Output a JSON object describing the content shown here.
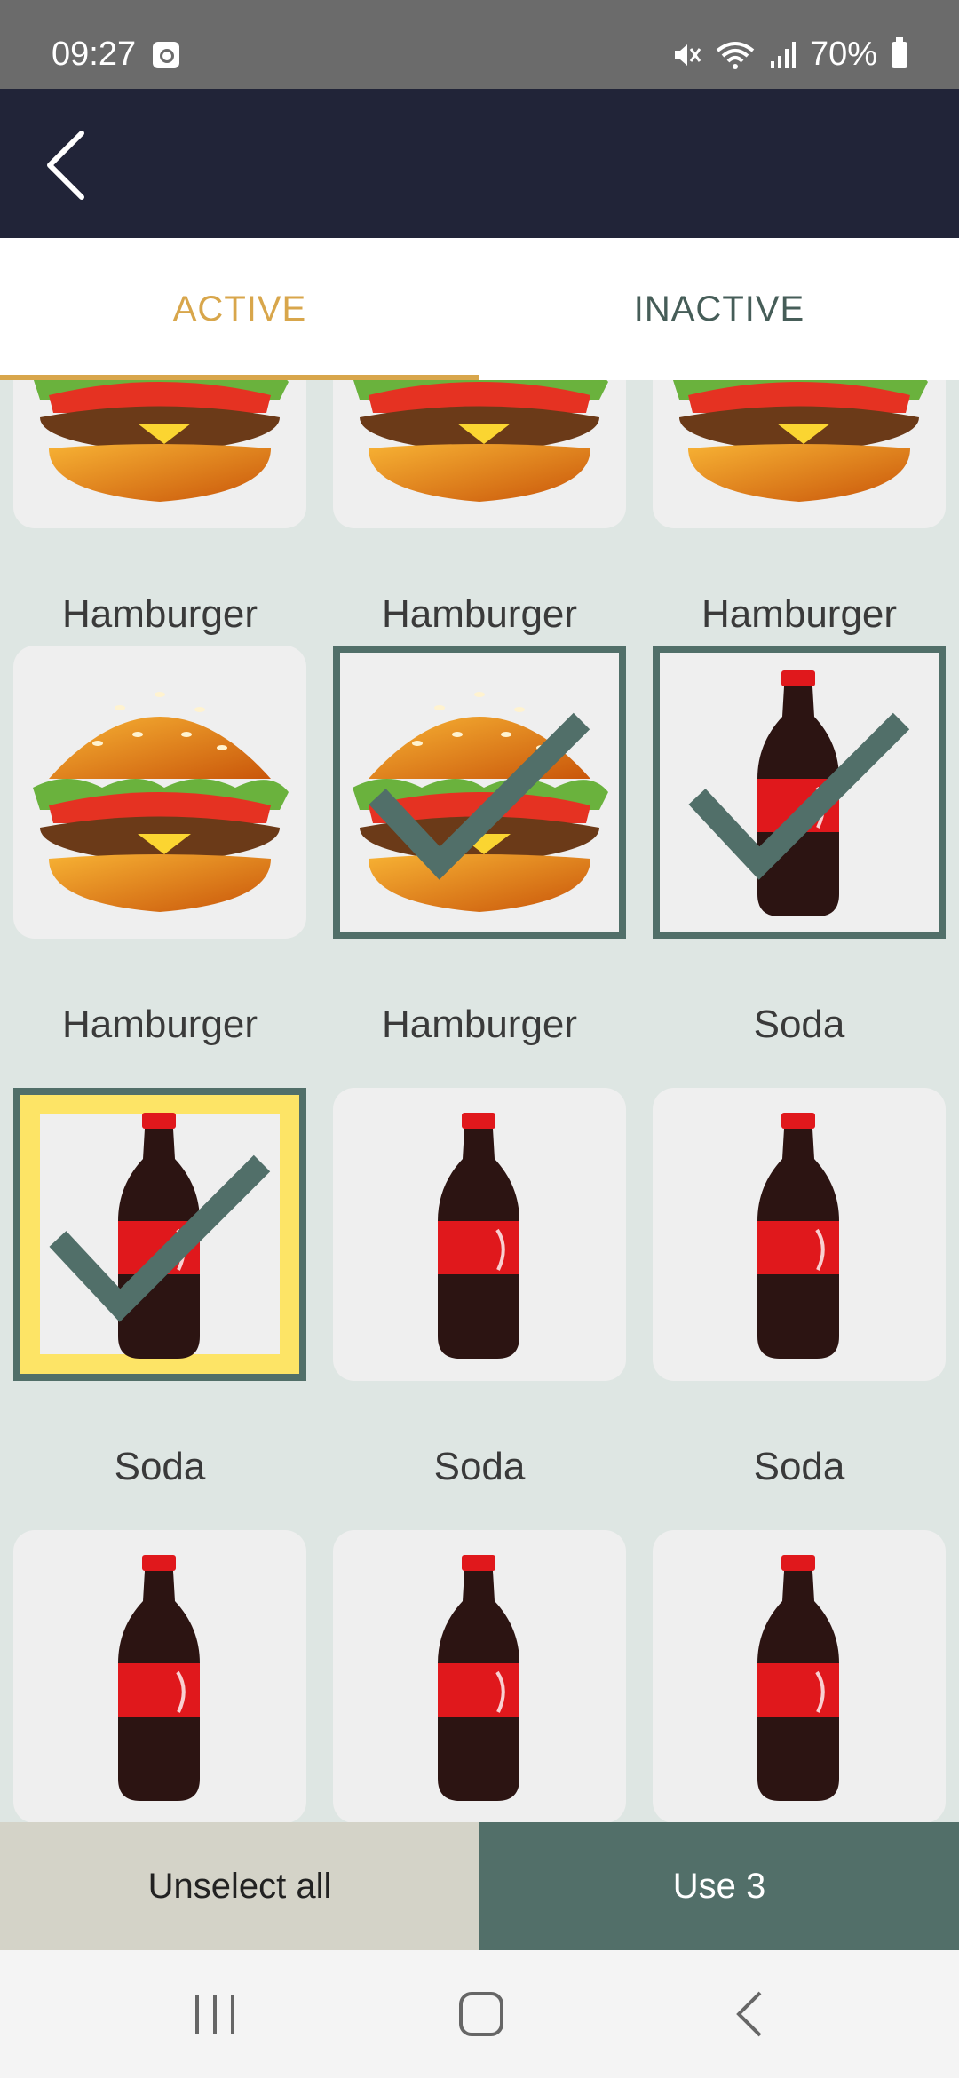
{
  "status_bar": {
    "time": "09:27",
    "battery": "70%"
  },
  "header": {
    "back_icon": "chevron-left-icon"
  },
  "tabs": [
    {
      "label": "ACTIVE",
      "active": true
    },
    {
      "label": "INACTIVE",
      "active": false
    }
  ],
  "grid": {
    "rows": [
      [
        {
          "label": "Hamburger",
          "kind": "burger",
          "state": "normal"
        },
        {
          "label": "Hamburger",
          "kind": "burger",
          "state": "normal"
        },
        {
          "label": "Hamburger",
          "kind": "burger",
          "state": "normal"
        }
      ],
      [
        {
          "label": "Hamburger",
          "kind": "burger",
          "state": "normal"
        },
        {
          "label": "Hamburger",
          "kind": "burger",
          "state": "selected"
        },
        {
          "label": "Soda",
          "kind": "soda",
          "state": "selected"
        }
      ],
      [
        {
          "label": "Soda",
          "kind": "soda",
          "state": "focused"
        },
        {
          "label": "Soda",
          "kind": "soda",
          "state": "normal"
        },
        {
          "label": "Soda",
          "kind": "soda",
          "state": "normal"
        }
      ],
      [
        {
          "label": "",
          "kind": "soda",
          "state": "normal"
        },
        {
          "label": "",
          "kind": "soda",
          "state": "normal"
        },
        {
          "label": "",
          "kind": "soda",
          "state": "normal"
        }
      ]
    ]
  },
  "buttons": {
    "unselect_all": "Unselect all",
    "use": "Use 3"
  },
  "colors": {
    "accent": "#d8a64b",
    "header": "#212438",
    "primary": "#526f69",
    "highlight": "#fde466"
  },
  "nav": [
    "recent-apps-icon",
    "home-icon",
    "back-icon"
  ]
}
